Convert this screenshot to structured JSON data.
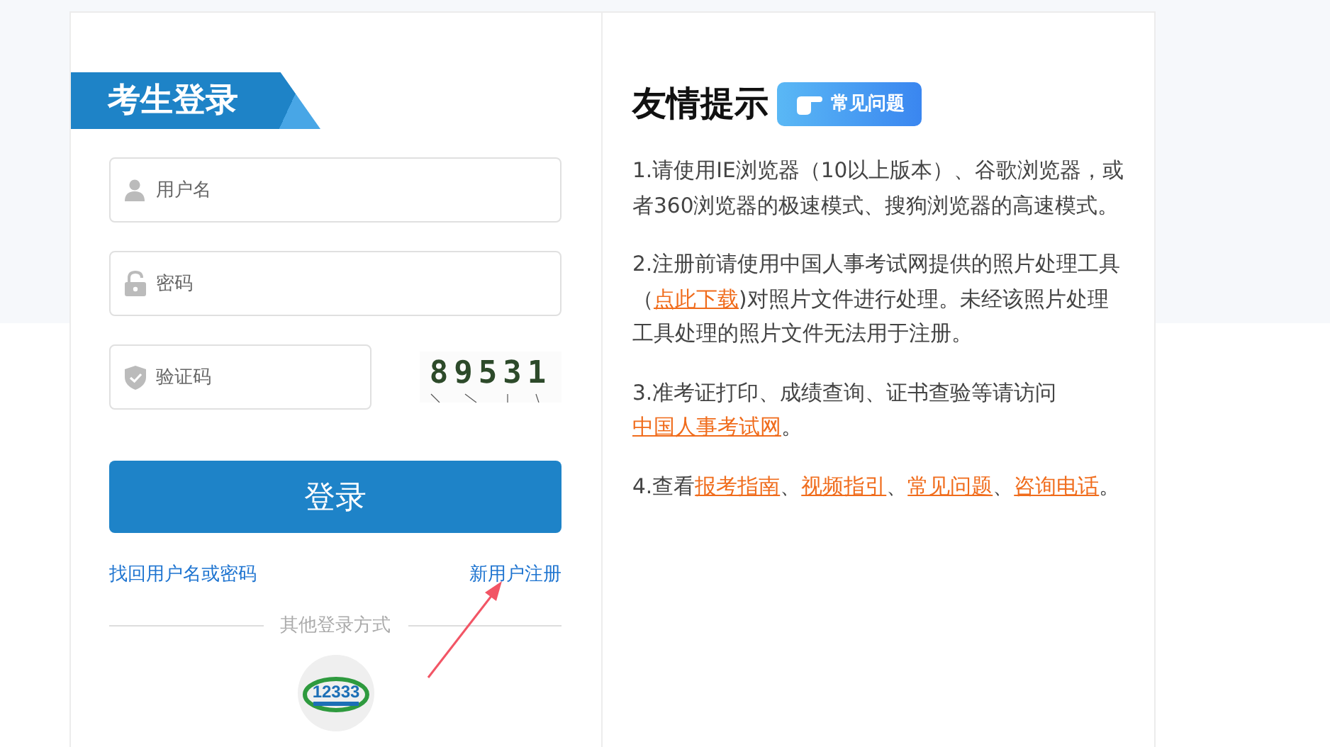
{
  "login": {
    "title": "考生登录",
    "fields": [
      {
        "kind": "user",
        "placeholder": "用户名"
      },
      {
        "kind": "lock",
        "placeholder": "密码"
      },
      {
        "kind": "shield",
        "placeholder": "验证码"
      }
    ],
    "captcha": "89531",
    "submit": "登录",
    "links": [
      "找回用户名或密码",
      "新用户注册"
    ],
    "other_login": {
      "label": "其他登录方式",
      "logo_text": "12333"
    }
  },
  "tips": {
    "title": "友情提示",
    "badge": "常见问题",
    "paragraphs": [
      [
        {
          "kind": "text",
          "text": "1.请使用IE浏览器（10以上版本）、谷歌浏览器，或者360浏览器的极速模式、搜狗浏览器的高速模式。"
        }
      ],
      [
        {
          "kind": "text",
          "text": "2.注册前请使用中国人事考试网提供的照片处理工具（"
        },
        {
          "kind": "link",
          "text": "点此下载"
        },
        {
          "kind": "text",
          "text": ")对照片文件进行处理。未经该照片处理工具处理的照片文件无法用于注册。"
        }
      ],
      [
        {
          "kind": "text",
          "text": "3.准考证打印、成绩查询、证书查验等请访问"
        },
        {
          "kind": "link",
          "text": "中国人事考试网"
        },
        {
          "kind": "text",
          "text": "。"
        }
      ],
      [
        {
          "kind": "text",
          "text": "4.查看"
        },
        {
          "kind": "link",
          "text": "报考指南"
        },
        {
          "kind": "text",
          "text": "、"
        },
        {
          "kind": "link",
          "text": "视频指引"
        },
        {
          "kind": "text",
          "text": "、"
        },
        {
          "kind": "link",
          "text": "常见问题"
        },
        {
          "kind": "text",
          "text": "、"
        },
        {
          "kind": "link",
          "text": "咨询电话"
        },
        {
          "kind": "text",
          "text": "。"
        }
      ]
    ]
  }
}
